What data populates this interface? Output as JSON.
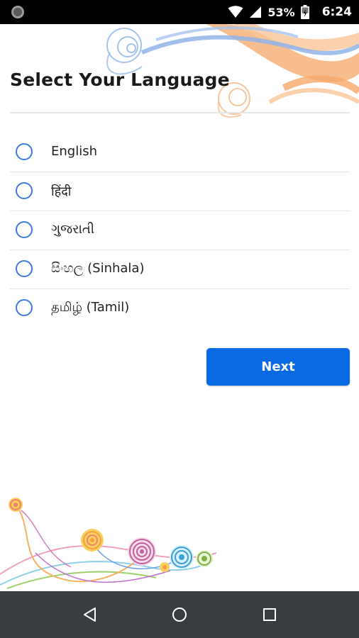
{
  "status_bar": {
    "battery": "53%",
    "time": "6:24",
    "icons": [
      "notification-dot-icon",
      "wifi-icon",
      "signal-icon",
      "battery-charging-icon"
    ]
  },
  "page": {
    "title": "Select Your Language"
  },
  "languages": [
    {
      "label": "English",
      "selected": false
    },
    {
      "label": "हिंदी",
      "selected": false
    },
    {
      "label": "ગુજરાતી",
      "selected": false
    },
    {
      "label": "සිංහල (Sinhala)",
      "selected": false
    },
    {
      "label": "தமிழ் (Tamil)",
      "selected": false
    }
  ],
  "actions": {
    "next_label": "Next"
  },
  "nav_bar": {
    "buttons": [
      "back-icon",
      "home-icon",
      "recents-icon"
    ]
  },
  "colors": {
    "accent": "#0a6ae4",
    "radio": "#3b7be0",
    "status_bar": "#000000",
    "nav_bar": "#3a3d40"
  }
}
